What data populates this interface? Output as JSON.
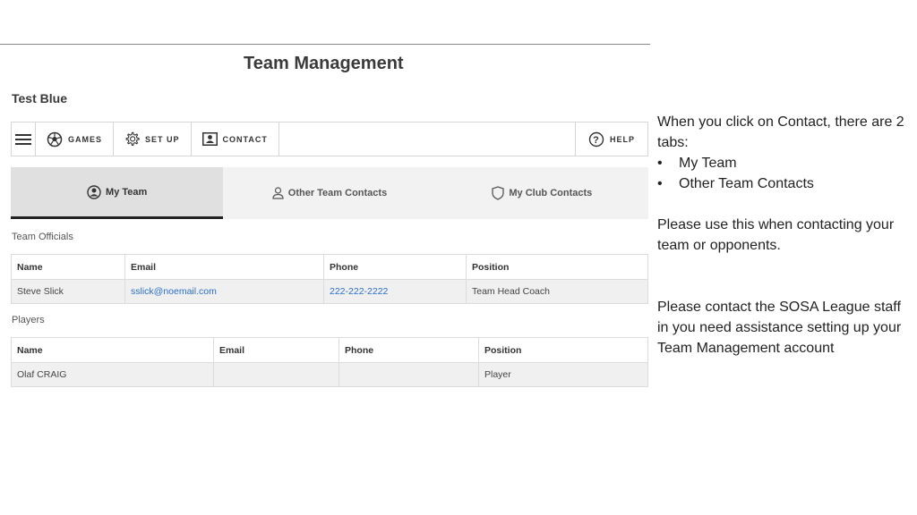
{
  "header": {
    "title": "Team Management",
    "team_name": "Test Blue"
  },
  "nav": {
    "games": "GAMES",
    "setup": "SET UP",
    "contact": "CONTACT",
    "help": "HELP"
  },
  "tabs": [
    {
      "label": "My Team",
      "active": true
    },
    {
      "label": "Other Team Contacts",
      "active": false
    },
    {
      "label": "My Club Contacts",
      "active": false
    }
  ],
  "officials": {
    "label": "Team Officials",
    "columns": [
      "Name",
      "Email",
      "Phone",
      "Position"
    ],
    "rows": [
      [
        "Steve Slick",
        "sslick@noemail.com",
        "222-222-2222",
        "Team Head Coach"
      ]
    ]
  },
  "players": {
    "label": "Players",
    "columns": [
      "Name",
      "Email",
      "Phone",
      "Position"
    ],
    "rows": [
      [
        "Olaf CRAIG",
        "",
        "",
        "Player"
      ]
    ]
  },
  "notes": {
    "intro": "When you click on Contact, there are 2 tabs:",
    "bullets": [
      "My Team",
      "Other Team Contacts"
    ],
    "usage": "Please use this when contacting your team or opponents.",
    "assist": "Please contact the SOSA League staff in you need assistance setting up your Team Management account"
  }
}
